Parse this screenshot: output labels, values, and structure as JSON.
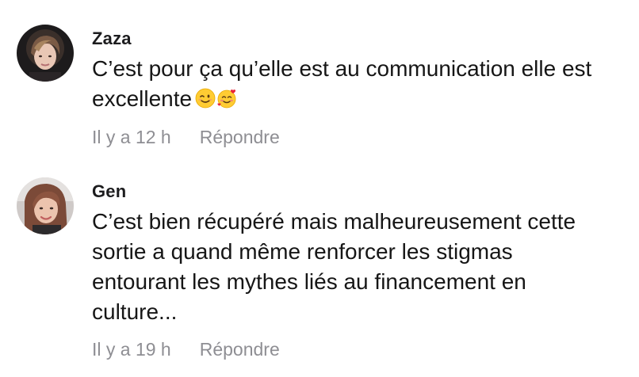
{
  "comments": [
    {
      "username": "Zaza",
      "text_lines": [
        "C’est pour ça qu’elle est au communication elle est",
        "excellente"
      ],
      "emojis": [
        "wink-emoji",
        "smiling-face-with-hearts-emoji"
      ],
      "time": "Il y a 12 h",
      "reply_label": "Répondre",
      "avatar_icon": "user-avatar-zaza"
    },
    {
      "username": "Gen",
      "text_lines": [
        "C’est bien récupéré mais malheureusement cette",
        "sortie a quand même renforcer les stigmas",
        "entourant les mythes liés au financement en",
        "culture..."
      ],
      "time": "Il y a 19 h",
      "reply_label": "Répondre",
      "avatar_icon": "user-avatar-gen"
    }
  ],
  "colors": {
    "text": "#161616",
    "username": "#1c1c1e",
    "meta": "#8e8e93",
    "background": "#ffffff"
  }
}
